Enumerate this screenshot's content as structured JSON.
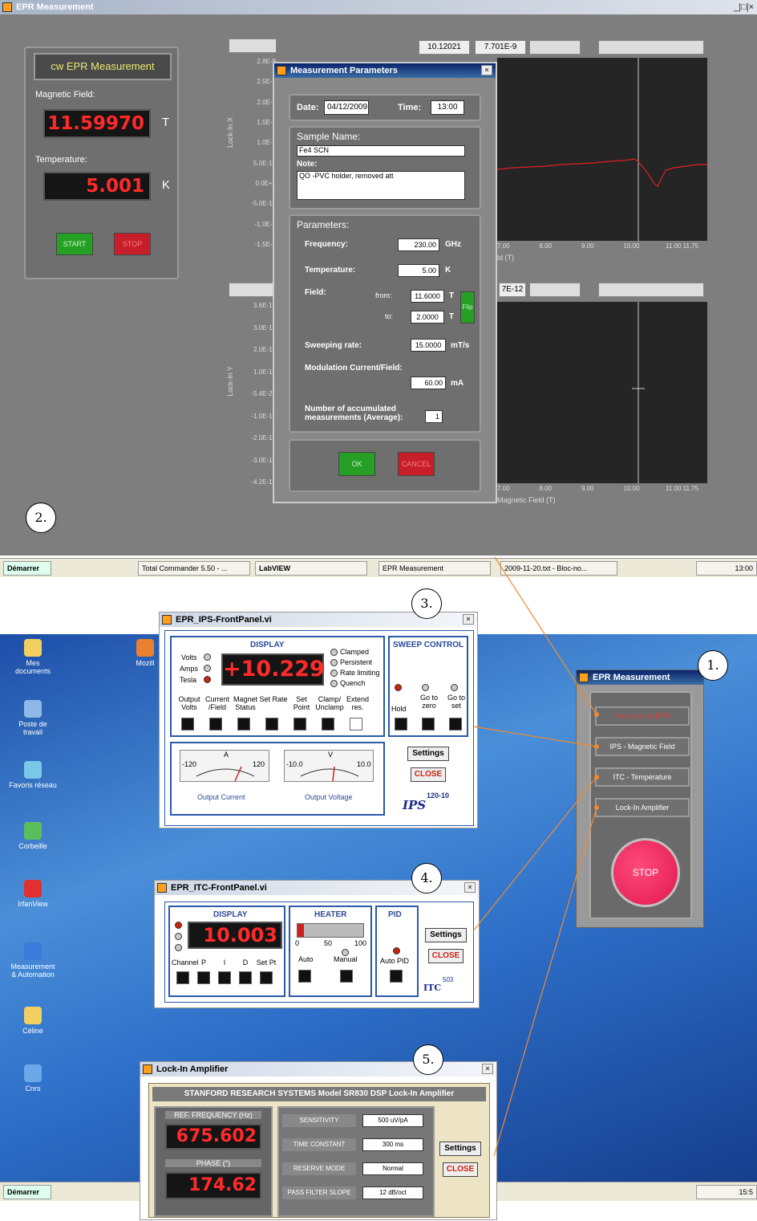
{
  "main_window": {
    "title": "EPR Measurement",
    "controls": "_|□|×"
  },
  "cw_panel": {
    "title": "cw EPR Measurement",
    "field_label": "Magnetic Field:",
    "field_value": "11.59970",
    "field_unit": "T",
    "temp_label": "Temperature:",
    "temp_value": "5.001",
    "temp_unit": "K",
    "start": "START",
    "stop": "STOP"
  },
  "graph_top": {
    "readout_x": "10.12021",
    "readout_y": "7.701E-9",
    "ylabel": "Lock-In X",
    "yticks": [
      "2.8E-9",
      "2.5E-9",
      "2.0E-9",
      "1.5E-9",
      "1.0E-9",
      "5.0E-10",
      "0.0E+0",
      "-5.0E-10",
      "-1.0E-9",
      "-1.5E-9"
    ],
    "xticks": [
      "7.00",
      "8.00",
      "9.00",
      "10.00",
      "11.00 11.75"
    ],
    "xlabel": "ld (T)"
  },
  "graph_bottom": {
    "readout": "7E-12",
    "ylabel": "Lock-In Y",
    "yticks": [
      "3.6E-10",
      "3.0E-10",
      "2.0E-10",
      "1.0E-10",
      "-5.4E-26",
      "-1.0E-10",
      "-2.0E-10",
      "-3.0E-10",
      "-4.2E-10"
    ],
    "xticks": [
      "7.00",
      "8.00",
      "9.00",
      "10.00",
      "11.00 11.75"
    ],
    "xlabel": "Magnetic Field (T)"
  },
  "dialog": {
    "title": "Measurement Parameters",
    "date_label": "Date:",
    "date": "04/12/2009",
    "time_label": "Time:",
    "time": "13:00",
    "sample_label": "Sample Name:",
    "sample": "Fe4 SCN",
    "note_label": "Note:",
    "note": "QO -PVC holder, removed att",
    "params_label": "Parameters:",
    "freq_label": "Frequency:",
    "freq": "230.00",
    "freq_unit": "GHz",
    "temp_label": "Temperature:",
    "temp": "5.00",
    "temp_unit": "K",
    "field_label": "Field:",
    "from_label": "from:",
    "from": "11.6000",
    "to_label": "to:",
    "to": "2.0000",
    "field_unit": "T",
    "flip": "Flip",
    "rate_label": "Sweeping rate:",
    "rate": "15.0000",
    "rate_unit": "mT/s",
    "mod_label": "Modulation Current/Field:",
    "mod": "60.00",
    "mod_unit": "mA",
    "avg_label": "Number of accumulated measurements (Average):",
    "avg": "1",
    "ok": "OK",
    "cancel": "CANCEL"
  },
  "taskbar1": {
    "start": "Démarrer",
    "items": [
      "Total Commander 5.50 - ...",
      "LabVIEW",
      "EPR Measurement",
      "2009-11-20.txt - Bloc-no..."
    ],
    "clock": "13:00"
  },
  "taskbar2": {
    "start": "Démarrer",
    "clock": "15:5"
  },
  "desktop_icons": [
    "Mes documents",
    "Poste de travail",
    "Favoris réseau",
    "Corbeille",
    "IrfanView",
    "Measurement & Automation",
    "Céline",
    "Cnrs",
    "Mozill"
  ],
  "ips": {
    "title": "EPR_IPS-FrontPanel.vi",
    "display": "DISPLAY",
    "value": "+10.229",
    "units": [
      "Volts",
      "Amps",
      "Tesla"
    ],
    "status": [
      "Clamped",
      "Persistent",
      "Rate limiting",
      "Quench"
    ],
    "buttons": [
      "Output Volts",
      "Current /Field",
      "Magnet Status",
      "Set Rate",
      "Set Point",
      "Clamp/ Unclamp",
      "Extend res."
    ],
    "sweep_title": "SWEEP CONTROL",
    "sweep": [
      "Hold",
      "Go to zero",
      "Go to set"
    ],
    "meter1_min": "-120",
    "meter1_max": "120",
    "meter1_unit": "A",
    "meter1_label": "Output Current",
    "meter2_min": "-10.0",
    "meter2_max": "10.0",
    "meter2_unit": "V",
    "meter2_label": "Output Voltage",
    "settings": "Settings",
    "close": "CLOSE",
    "brand": "IPS",
    "model": "120-10"
  },
  "itc": {
    "title": "EPR_ITC-FrontPanel.vi",
    "display": "DISPLAY",
    "value": "10.003",
    "buttons": [
      "Channel",
      "P",
      "I",
      "D",
      "Set Pt"
    ],
    "heater": "HEATER",
    "heater_ticks": [
      "0",
      "50",
      "100"
    ],
    "heater_pct": 0.1,
    "auto": "Auto",
    "manual": "Manual",
    "pid": "PID",
    "auto_pid": "Auto PID",
    "settings": "Settings",
    "close": "CLOSE",
    "brand": "ITC",
    "model": "503"
  },
  "lia": {
    "title": "Lock-In Amplifier",
    "header": "STANFORD RESEARCH SYSTEMS  Model SR830 DSP Lock-In Amplifier",
    "ref_label": "REF. FREQUENCY (Hz)",
    "ref": "675.602",
    "phase_label": "PHASE (°)",
    "phase": "174.62",
    "rows": [
      {
        "label": "SENSITIVITY",
        "value": "500 uV/pA"
      },
      {
        "label": "TIME CONSTANT",
        "value": "300 ms"
      },
      {
        "label": "RESERVE MODE",
        "value": "Normal"
      },
      {
        "label": "PASS FILTER SLOPE",
        "value": "12 dB/oct"
      }
    ],
    "settings": "Settings",
    "close": "CLOSE"
  },
  "launcher": {
    "title": "EPR Measurement",
    "buttons": [
      "Measure cw EPR",
      "IPS - Magnetic Field",
      "ITC - Temperature",
      "Lock-In Amplifier"
    ],
    "stop": "STOP"
  },
  "callouts": [
    "1.",
    "2.",
    "3.",
    "4.",
    "5."
  ]
}
